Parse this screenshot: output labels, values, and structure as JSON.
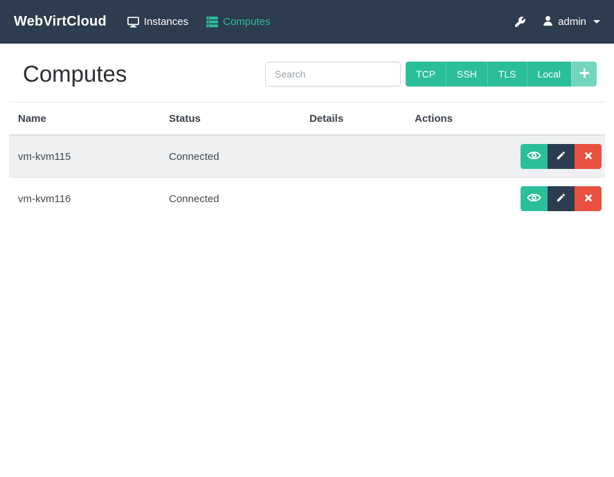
{
  "navbar": {
    "brand": "WebVirtCloud",
    "items": [
      {
        "label": "Instances",
        "icon": "monitor-icon",
        "active": false
      },
      {
        "label": "Computes",
        "icon": "server-stack-icon",
        "active": true
      }
    ],
    "tools_icon": "wrench-icon",
    "user": {
      "icon": "user-icon",
      "label": "admin"
    }
  },
  "page": {
    "title": "Computes"
  },
  "search": {
    "placeholder": "Search",
    "value": ""
  },
  "connection_type_buttons": [
    {
      "label": "TCP"
    },
    {
      "label": "SSH"
    },
    {
      "label": "TLS"
    },
    {
      "label": "Local"
    }
  ],
  "add_button": {
    "icon": "plus-icon"
  },
  "table": {
    "columns": [
      "Name",
      "Status",
      "Details",
      "Actions"
    ],
    "rows": [
      {
        "name": "vm-kvm115",
        "status": "Connected",
        "details": ""
      },
      {
        "name": "vm-kvm116",
        "status": "Connected",
        "details": ""
      }
    ],
    "row_actions": [
      "view-eye-icon",
      "edit-pencil-icon",
      "delete-x-icon"
    ]
  },
  "colors": {
    "navbar_bg": "#2d3c4e",
    "accent_teal": "#2bbe9b",
    "accent_teal_light": "#72d6bf",
    "danger_red": "#e8503f",
    "striped_row_bg": "#eef0f1",
    "border": "#e6e8ea",
    "text_dark": "#2b2e33"
  }
}
